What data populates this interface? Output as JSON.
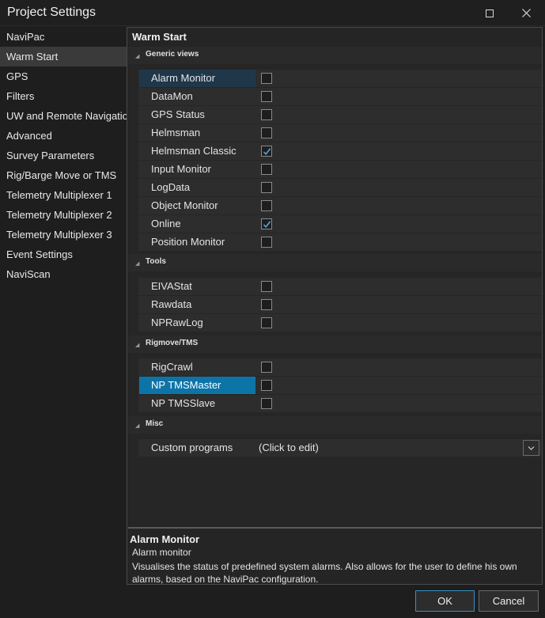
{
  "window": {
    "title": "Project Settings"
  },
  "sidebar": {
    "items": [
      {
        "label": "NaviPac"
      },
      {
        "label": "Warm Start"
      },
      {
        "label": "GPS"
      },
      {
        "label": "Filters"
      },
      {
        "label": "UW and Remote Navigation"
      },
      {
        "label": "Advanced"
      },
      {
        "label": "Survey Parameters"
      },
      {
        "label": "Rig/Barge Move or TMS"
      },
      {
        "label": "Telemetry Multiplexer 1"
      },
      {
        "label": "Telemetry Multiplexer 2"
      },
      {
        "label": "Telemetry Multiplexer 3"
      },
      {
        "label": "Event Settings"
      },
      {
        "label": "NaviScan"
      }
    ],
    "selected": "Warm Start"
  },
  "panel": {
    "title": "Warm Start",
    "categories": [
      {
        "label": "Generic views",
        "rows": [
          {
            "name": "Alarm Monitor",
            "checked": false
          },
          {
            "name": "DataMon",
            "checked": false
          },
          {
            "name": "GPS Status",
            "checked": false
          },
          {
            "name": "Helmsman",
            "checked": false
          },
          {
            "name": "Helmsman Classic",
            "checked": true
          },
          {
            "name": "Input Monitor",
            "checked": false
          },
          {
            "name": "LogData",
            "checked": false
          },
          {
            "name": "Object Monitor",
            "checked": false
          },
          {
            "name": "Online",
            "checked": true
          },
          {
            "name": "Position Monitor",
            "checked": false
          }
        ]
      },
      {
        "label": "Tools",
        "rows": [
          {
            "name": "EIVAStat",
            "checked": false
          },
          {
            "name": "Rawdata",
            "checked": false
          },
          {
            "name": "NPRawLog",
            "checked": false
          }
        ]
      },
      {
        "label": "Rigmove/TMS",
        "rows": [
          {
            "name": "RigCrawl",
            "checked": false
          },
          {
            "name": "NP TMSMaster",
            "checked": false
          },
          {
            "name": "NP TMSSlave",
            "checked": false
          }
        ]
      },
      {
        "label": "Misc",
        "rows": [
          {
            "name": "Custom programs",
            "value": "(Click to edit)"
          }
        ]
      }
    ],
    "description": {
      "title": "Alarm Monitor",
      "subtitle": "Alarm monitor",
      "text": "Visualises the status of predefined system alarms. Also allows for the user to define his own alarms, based on the NaviPac configuration."
    }
  },
  "buttons": {
    "ok": "OK",
    "cancel": "Cancel"
  },
  "colors": {
    "accent": "#0d74a8",
    "background": "#1e1e1e",
    "check": "#5aa6d6"
  }
}
